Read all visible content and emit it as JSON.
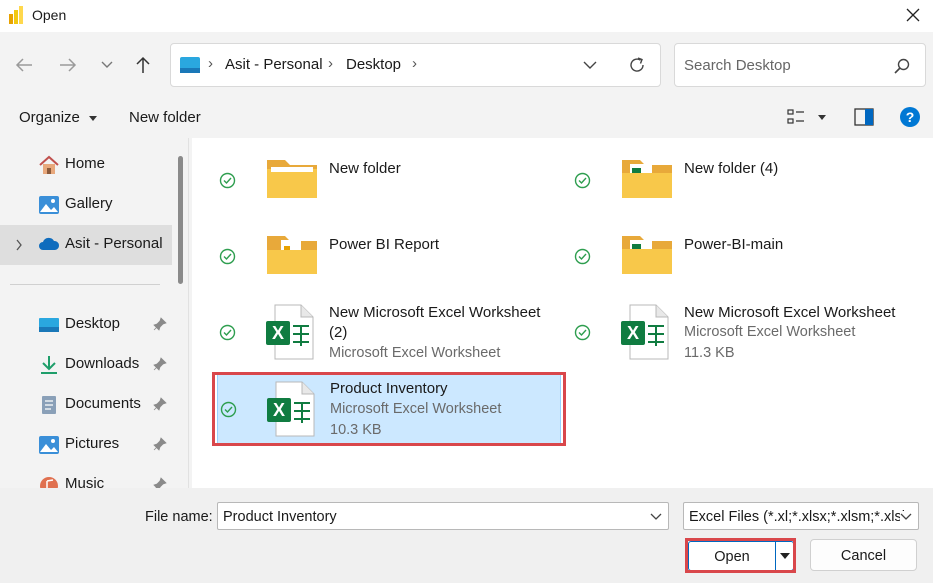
{
  "window": {
    "title": "Open"
  },
  "address": {
    "crumbs": [
      "Asit - Personal",
      "Desktop"
    ]
  },
  "search": {
    "placeholder": "Search Desktop"
  },
  "toolbar": {
    "organize_label": "Organize",
    "new_folder_label": "New folder"
  },
  "sidebar": {
    "items": [
      {
        "label": "Home",
        "icon": "home-icon"
      },
      {
        "label": "Gallery",
        "icon": "gallery-icon"
      },
      {
        "label": "Asit - Personal",
        "icon": "onedrive-cloud-icon",
        "selected": true
      },
      {
        "label": "Desktop",
        "icon": "desktop-icon",
        "pinned": true
      },
      {
        "label": "Downloads",
        "icon": "downloads-icon",
        "pinned": true
      },
      {
        "label": "Documents",
        "icon": "documents-icon",
        "pinned": true
      },
      {
        "label": "Pictures",
        "icon": "pictures-icon",
        "pinned": true
      },
      {
        "label": "Music",
        "icon": "music-icon",
        "pinned": true
      }
    ]
  },
  "files": [
    {
      "name": "New folder",
      "kind": "folder"
    },
    {
      "name": "New folder (4)",
      "kind": "folder-excel"
    },
    {
      "name": "Power BI Report",
      "kind": "folder-doc"
    },
    {
      "name": "Power-BI-main",
      "kind": "folder-excel"
    },
    {
      "name": "New Microsoft Excel Worksheet",
      "name2": "(2)",
      "type": "Microsoft Excel Worksheet",
      "kind": "excel"
    },
    {
      "name": "New Microsoft Excel Worksheet",
      "type": "Microsoft Excel Worksheet",
      "size": "11.3 KB",
      "kind": "excel"
    },
    {
      "name": "Product Inventory",
      "type": "Microsoft Excel Worksheet",
      "size": "10.3 KB",
      "kind": "excel",
      "selected": true
    }
  ],
  "footer": {
    "file_name_label": "File name:",
    "file_name_value": "Product Inventory",
    "file_type_value": "Excel Files (*.xl;*.xlsx;*.xlsm;*.xlsb",
    "open_label": "Open",
    "cancel_label": "Cancel"
  },
  "colors": {
    "accent": "#0067c0",
    "selection": "#cce8ff",
    "highlight_box": "#d9474b",
    "excel_green": "#107c41",
    "folder_yellow": "#f8c84a",
    "sync_green": "#2e9e4f"
  }
}
